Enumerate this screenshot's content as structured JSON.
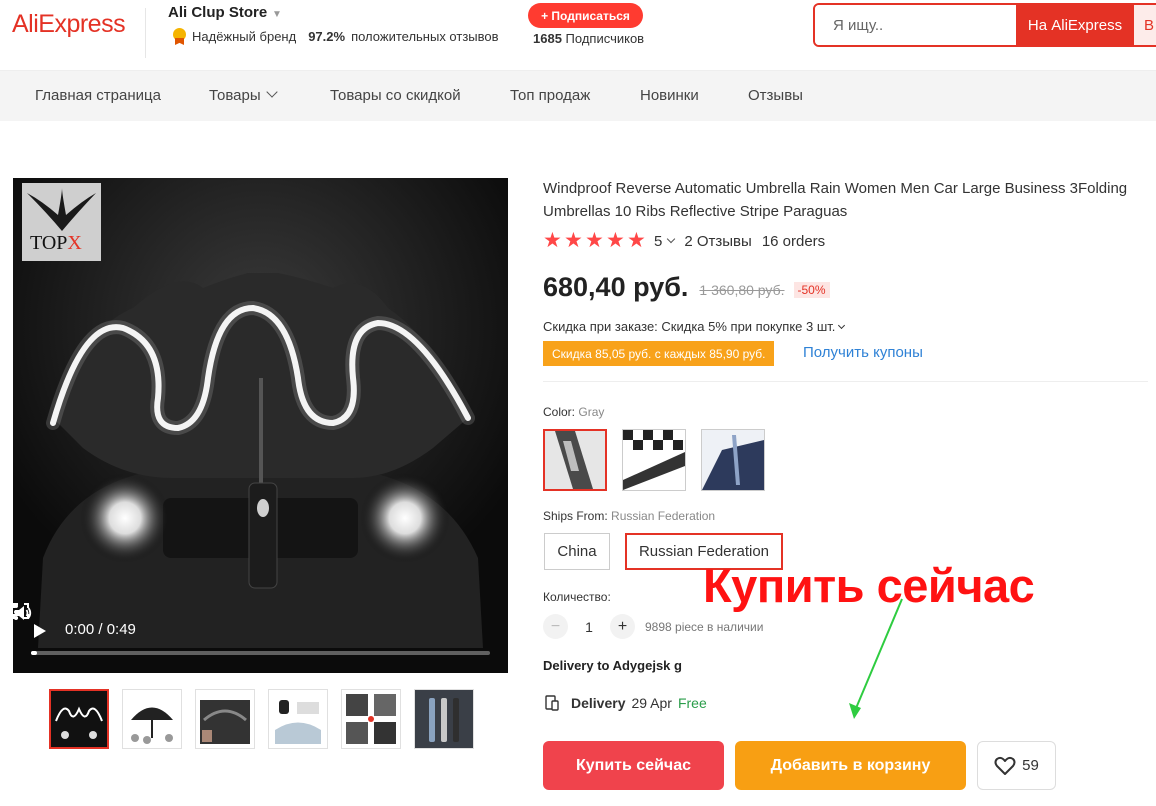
{
  "header": {
    "logo": "AliExpress",
    "store_name": "Ali Clup Store",
    "trust_label": "Надёжный бренд",
    "positive_pct": "97.2%",
    "positive_label": "положительных отзывов",
    "subscribe_label": "+ Подписаться",
    "subscribers_count": "1685",
    "subscribers_label": "Подписчиков",
    "search_placeholder": "Я ищу..",
    "search_button": "На AliExpress",
    "search_button2": "В"
  },
  "nav": {
    "items": [
      {
        "label": "Главная страница"
      },
      {
        "label": "Товары"
      },
      {
        "label": "Товары со скидкой"
      },
      {
        "label": "Топ продаж"
      },
      {
        "label": "Новинки"
      },
      {
        "label": "Отзывы"
      }
    ]
  },
  "video": {
    "watermark": "TOP",
    "watermark_x": "X",
    "time": "0:00 / 0:49",
    "progress_fraction": 0.01
  },
  "product": {
    "title": "Windproof Reverse Automatic Umbrella Rain Women Men Car Large Business 3Folding Umbrellas 10 Ribs Reflective Stripe Paraguas",
    "rating": "5",
    "stars": 5,
    "reviews": "2 Отзывы",
    "orders": "16 orders",
    "price": "680,40 руб.",
    "old_price": "1 360,80 руб.",
    "discount": "-50%",
    "promo_line": "Скидка при заказе: Скидка 5% при покупке 3 шт.",
    "coupon_tag": "Скидка 85,05 руб. с каждых 85,90 руб.",
    "coupon_link": "Получить купоны",
    "color_label": "Color:",
    "color_value": "Gray",
    "ships_label": "Ships From:",
    "ships_value": "Russian Federation",
    "ship_options": [
      "China",
      "Russian Federation"
    ],
    "qty_label": "Количество:",
    "qty_minus": "−",
    "qty_value": "1",
    "qty_plus": "+",
    "stock": "9898 piece в наличии",
    "delivery_to": "Delivery to Adygejsk g",
    "delivery_label": "Delivery",
    "delivery_date": "29 Apr",
    "delivery_free": "Free",
    "buy_label": "Купить сейчас",
    "cart_label": "Добавить в корзину",
    "wish_count": "59"
  },
  "annotation": {
    "text": "Купить сейчас",
    "color": "#ff1212",
    "arrow_color": "#2ecc40"
  },
  "colors": {
    "brand_red": "#e43225",
    "buy_red": "#f0434c",
    "cart_orange": "#f89f13",
    "coupon_orange": "#f8a21a",
    "link_blue": "#2f82d6"
  }
}
